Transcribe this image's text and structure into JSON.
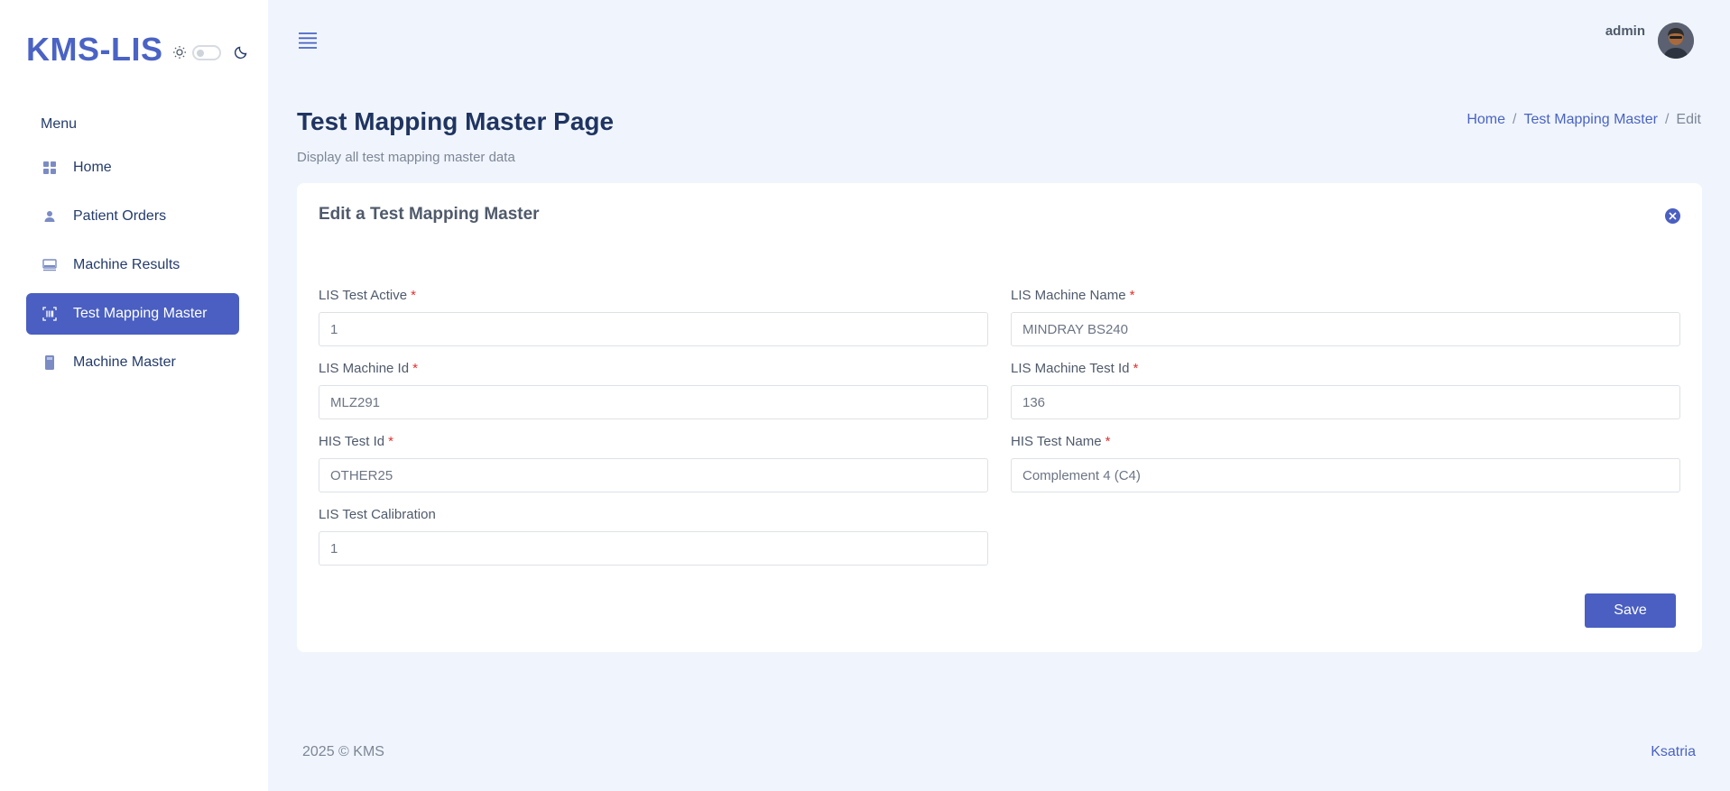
{
  "brand": {
    "name": "KMS-LIS"
  },
  "sidebar": {
    "menu_heading": "Menu",
    "items": [
      {
        "label": "Home",
        "icon": "grid-icon",
        "active": false
      },
      {
        "label": "Patient Orders",
        "icon": "user-icon",
        "active": false
      },
      {
        "label": "Machine Results",
        "icon": "monitor-icon",
        "active": false
      },
      {
        "label": "Test Mapping Master",
        "icon": "scan-icon",
        "active": true
      },
      {
        "label": "Machine Master",
        "icon": "device-icon",
        "active": false
      }
    ]
  },
  "header": {
    "user_name": "admin"
  },
  "page": {
    "title": "Test Mapping Master Page",
    "subtitle": "Display all test mapping master data",
    "breadcrumb": [
      "Home",
      "Test Mapping Master",
      "Edit"
    ]
  },
  "form": {
    "title": "Edit a Test Mapping Master",
    "fields": {
      "lis_test_active": {
        "label": "LIS Test Active",
        "value": "1",
        "required": true
      },
      "lis_machine_name": {
        "label": "LIS Machine Name",
        "value": "MINDRAY BS240",
        "required": true
      },
      "lis_machine_id": {
        "label": "LIS Machine Id",
        "value": "MLZ291",
        "required": true
      },
      "lis_machine_test_id": {
        "label": "LIS Machine Test Id",
        "value": "136",
        "required": true
      },
      "his_test_id": {
        "label": "HIS Test Id",
        "value": "OTHER25",
        "required": true
      },
      "his_test_name": {
        "label": "HIS Test Name",
        "value": "Complement 4 (C4)",
        "required": true
      },
      "lis_test_calibration": {
        "label": "LIS Test Calibration",
        "value": "1",
        "required": false
      }
    },
    "required_marker": "*",
    "save_label": "Save"
  },
  "footer": {
    "copyright": "2025 © KMS",
    "vendor": "Ksatria"
  },
  "colors": {
    "accent": "#4a5fc1",
    "brand": "#4a63c4",
    "required": "#e03131",
    "background": "#f0f5fd"
  }
}
